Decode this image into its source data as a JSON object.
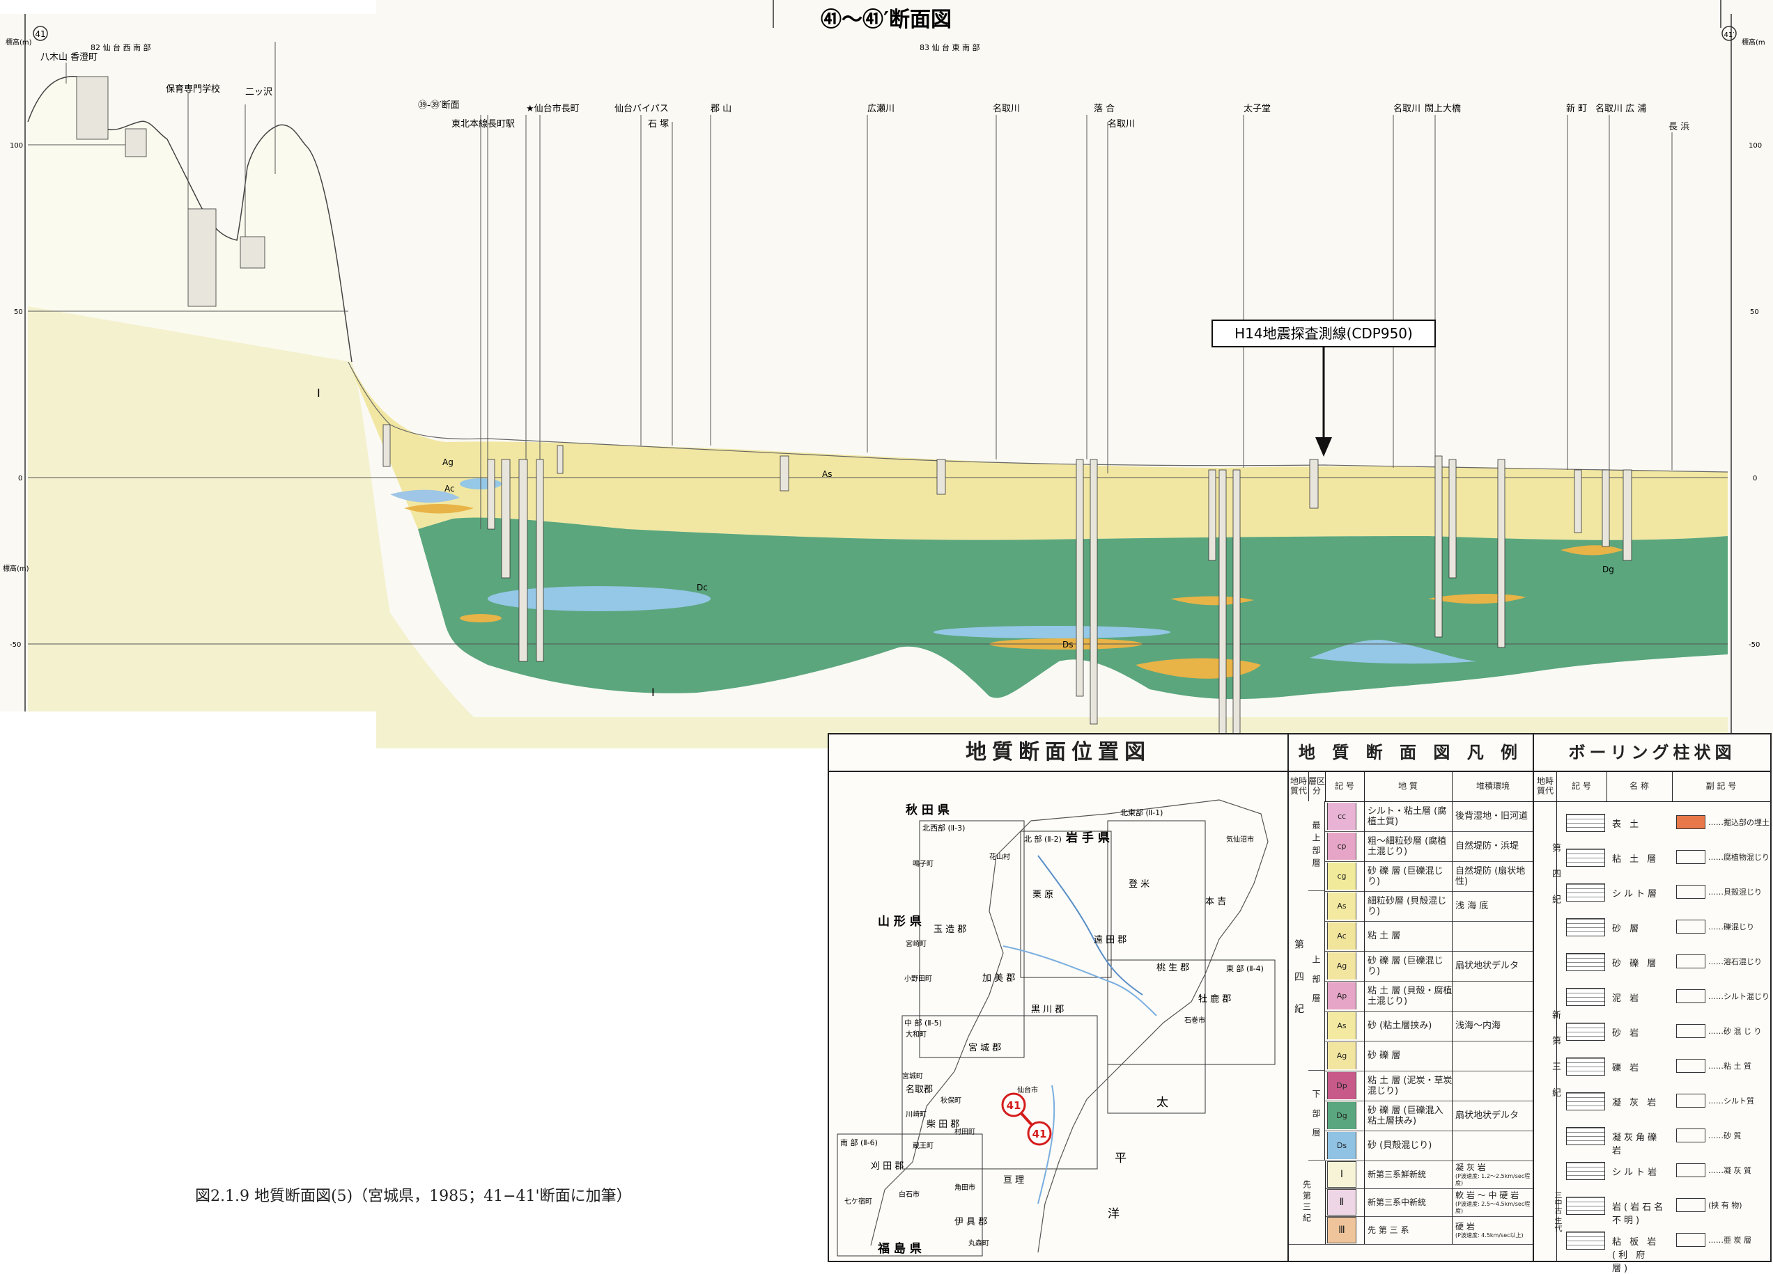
{
  "section": {
    "title": "㊶～㊶′断面図",
    "left_marker": "41",
    "right_marker": "41′",
    "elev_label_left": "標高(m)",
    "elev_label_right": "標高(m",
    "elev_label_left_neg": "標高(m)",
    "sheet_left": "82 仙 台 西 南 部",
    "sheet_right": "83 仙 台 東 南 部",
    "elevations": [
      "100",
      "50",
      "0",
      "-50"
    ],
    "places": [
      "八木山 香澄町",
      "保育専門学校",
      "二ッ沢",
      "㊴-㊴′断面",
      "東北本線長町駅",
      "★仙台市長町",
      "仙台バイパス",
      "石 塚",
      "郡 山",
      "広瀬川",
      "名取川",
      "落 合",
      "名取川",
      "太子堂",
      "名取川",
      "閖上大橋",
      "新 町",
      "名取川 広 浦",
      "長 浜"
    ],
    "units": [
      "Ag",
      "Ac",
      "As",
      "Dg",
      "Dc",
      "Ds",
      "I",
      "I"
    ],
    "unit_color_map": {
      "Ag": "#f2e7a4",
      "As": "#f1e49b",
      "Ac": "#9fc6e6",
      "Dg": "#5aa77f",
      "Dc": "#93c5e6",
      "Ds": "#e8b347",
      "I": "#f4f1d0"
    },
    "callout": "H14地震探査測線(CDP950)"
  },
  "caption": "図2.1.9 地質断面図(5)（宮城県，1985；41−41'断面に加筆）",
  "map_panel": {
    "title": "地質断面位置図",
    "prefectures": [
      "秋 田 県",
      "岩 手 県",
      "山 形 県",
      "福 島 県"
    ],
    "sheets": [
      "北西部 (Ⅱ-3)",
      "北 部 (Ⅱ-2)",
      "北東部 (Ⅱ-1)",
      "東 部 (Ⅱ-4)",
      "中 部 (Ⅱ-5)",
      "南 部 (Ⅱ-6)"
    ],
    "districts": [
      "玉 造 郡",
      "栗 原",
      "遠 田 郡",
      "桃 生 郡",
      "本 吉",
      "登 米",
      "加 美 郡",
      "黒 川 郡",
      "宮 城 郡",
      "名取郡",
      "柴 田 郡",
      "刈 田 郡",
      "伊 具 郡",
      "亘 理",
      "牡 鹿 郡"
    ],
    "towns": [
      "鳴子町",
      "花山村",
      "宮崎町",
      "小野田町",
      "大和町",
      "宮城町",
      "秋保町",
      "川崎町",
      "村田町",
      "蔵王町",
      "七ケ宿町",
      "白石市",
      "角田市",
      "丸森町",
      "仙台市",
      "石巻市",
      "気仙沼市"
    ],
    "sea": [
      "太",
      "平",
      "洋"
    ],
    "section_marks": [
      "41",
      "41"
    ]
  },
  "legend_panel": {
    "title": "地 質 断 面 図 凡 例",
    "headers": [
      "地時質代",
      "層区分",
      "記 号",
      "地 質",
      "堆積環境"
    ],
    "era": "第 四 紀",
    "groups": [
      "最上部層",
      "上 部 層",
      "下 部 層"
    ],
    "rows": [
      {
        "sym": "cc",
        "geo": "シルト・粘土層 (腐植土質)",
        "env": "後背湿地・旧河道",
        "color": "#e8b3d4"
      },
      {
        "sym": "cp",
        "geo": "粗～細粒砂層 (腐植土混じり)",
        "env": "自然堤防・浜堤",
        "color": "#e6a5c6"
      },
      {
        "sym": "cg",
        "geo": "砂 礫 層 (巨礫混じり)",
        "env": "自然堤防 (扇状地性)",
        "color": "#f0ea9a"
      },
      {
        "sym": "As",
        "geo": "細粒砂層 (貝殻混じり)",
        "env": "浅 海 底",
        "color": "#f3e9a0"
      },
      {
        "sym": "Ac",
        "geo": "粘 土 層",
        "env": "",
        "color": "#f1e49b"
      },
      {
        "sym": "Ag",
        "geo": "砂 礫 層 (巨礫混じり)",
        "env": "扇状地状デルタ",
        "color": "#f2e5a0"
      },
      {
        "sym": "Ap",
        "geo": "粘 土 層 (貝殻・腐植土混じり)",
        "env": "",
        "color": "#e6a5c6"
      },
      {
        "sym": "As",
        "geo": "砂 (粘土層挟み)",
        "env": "浅海～内海",
        "color": "#f3e9a0"
      },
      {
        "sym": "Ag",
        "geo": "砂 礫 層",
        "env": "",
        "color": "#f2e5a0"
      },
      {
        "sym": "Dp",
        "geo": "粘 土 層 (泥炭・草炭混じり)",
        "env": "",
        "color": "#c85a8a"
      },
      {
        "sym": "Dg",
        "geo": "砂 礫 層 (巨礫混入 粘土層挟み)",
        "env": "扇状地状デルタ",
        "color": "#5aa77f"
      },
      {
        "sym": "Ds",
        "geo": "砂 (貝殻混じり)",
        "env": "",
        "color": "#8fc2e3"
      }
    ],
    "basement": [
      {
        "sym": "Ⅰ",
        "era": "新第三系鮮新統",
        "geo": "凝 灰 岩",
        "note": "(P波速度: 1.2～2.5km/sec程度)",
        "color": "#f6f3d6"
      },
      {
        "sym": "Ⅱ",
        "era": "新第三系中新統",
        "geo": "軟 岩 ～ 中 硬 岩",
        "note": "(P波速度: 2.5～4.5km/sec程度)",
        "color": "#efd6e6"
      },
      {
        "sym": "Ⅲ",
        "era": "先 第 三 系",
        "geo": "硬 岩",
        "note": "(P波速度: 4.5km/sec以上)",
        "color": "#efc49a"
      }
    ],
    "basement_era": "先第三紀"
  },
  "boring_panel": {
    "title": "ボーリング柱状図",
    "headers": [
      "地時質代",
      "記 号",
      "名 称",
      "副 記 号"
    ],
    "quaternary": "第 四 紀",
    "tertiary": "新 第 三 紀",
    "pretertiary": "三中古 生代",
    "items": [
      "表 土",
      "粘 土 層",
      "シルト層",
      "砂 層",
      "砂 礫 層",
      "泥 岩",
      "砂 岩",
      "礫 岩",
      "凝 灰 岩",
      "凝灰角礫岩",
      "シルト岩",
      "岩(岩石名不明)",
      "粘 板 岩 (利 府 層)"
    ],
    "sub": [
      "……掘込部の埋土",
      "……腐植物混じり",
      "……貝殻混じり",
      "……礫混じり",
      "……溶石混じり",
      "……シルト混じり",
      "……砂 混 じ り",
      "……粘 土 質",
      "……シルト質",
      "……砂 質",
      "……凝 灰 質",
      "(挟 有 物)",
      "……亜 炭 層"
    ]
  }
}
